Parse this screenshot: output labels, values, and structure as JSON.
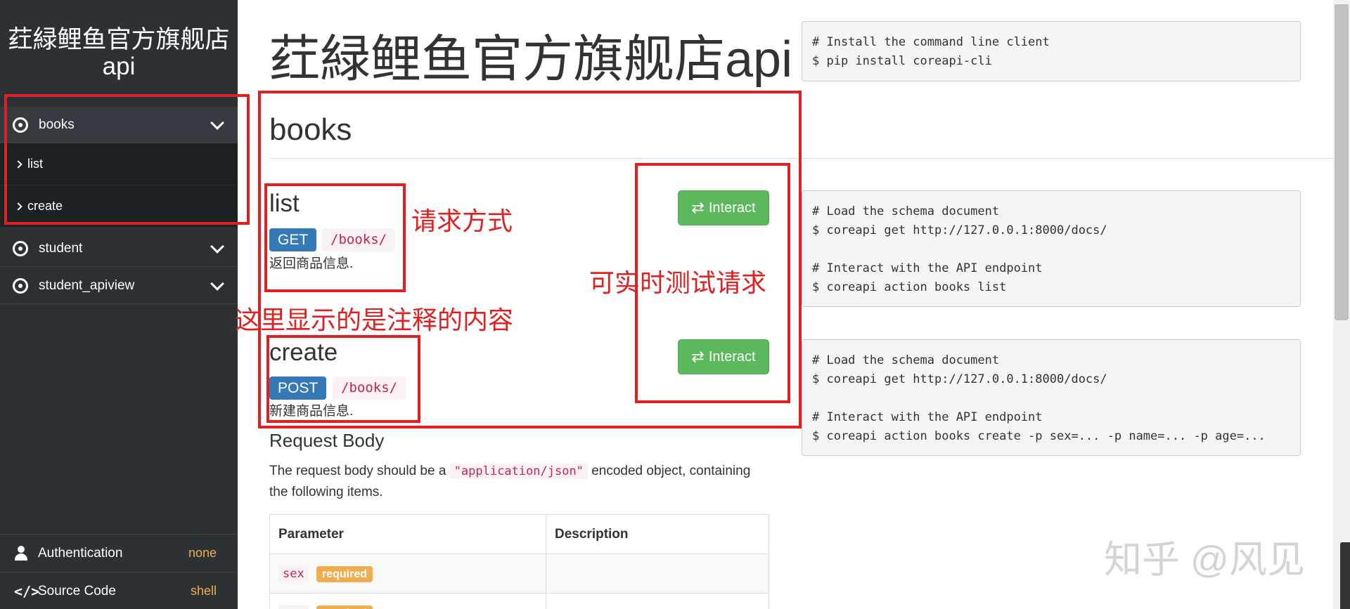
{
  "site": {
    "title": "荭緑鲤鱼官方旗舰店api"
  },
  "sidebar": {
    "groups": [
      {
        "label": "books",
        "items": [
          {
            "label": "list"
          },
          {
            "label": "create"
          }
        ]
      },
      {
        "label": "student"
      },
      {
        "label": "student_apiview"
      }
    ],
    "authentication": {
      "label": "Authentication",
      "value": "none"
    },
    "source_code": {
      "label": "Source Code",
      "value": "shell"
    }
  },
  "main": {
    "title": "荭緑鲤鱼官方旗舰店api",
    "install_code": "# Install the command line client\n$ pip install coreapi-cli",
    "section_title": "books",
    "endpoints": [
      {
        "name": "list",
        "method": "GET",
        "path": "/books/",
        "description": "返回商品信息.",
        "interact_label": "Interact",
        "code": "# Load the schema document\n$ coreapi get http://127.0.0.1:8000/docs/\n\n# Interact with the API endpoint\n$ coreapi action books list"
      },
      {
        "name": "create",
        "method": "POST",
        "path": "/books/",
        "description": "新建商品信息.",
        "interact_label": "Interact",
        "code": "# Load the schema document\n$ coreapi get http://127.0.0.1:8000/docs/\n\n# Interact with the API endpoint\n$ coreapi action books create -p sex=... -p name=... -p age=..."
      }
    ],
    "request_body": {
      "title": "Request Body",
      "text_before": "The request body should be a",
      "content_type": "\"application/json\"",
      "text_after": "encoded object, containing the following items.",
      "table": {
        "headers": [
          "Parameter",
          "Description"
        ],
        "rows": [
          {
            "name": "sex",
            "badge": "required"
          }
        ],
        "next_row_badge": "required"
      }
    }
  },
  "annotations": {
    "request_method": "请求方式",
    "realtime_test": "可实时测试请求",
    "comment_content": "这里显示的是注释的内容"
  },
  "watermark": "知乎 @风见",
  "colors": {
    "sidebar_bg": "#2c3136",
    "annotation": "#e02020",
    "get_badge": "#337ab7",
    "interact_btn": "#5cb85c",
    "required_badge": "#f0ad4e"
  }
}
